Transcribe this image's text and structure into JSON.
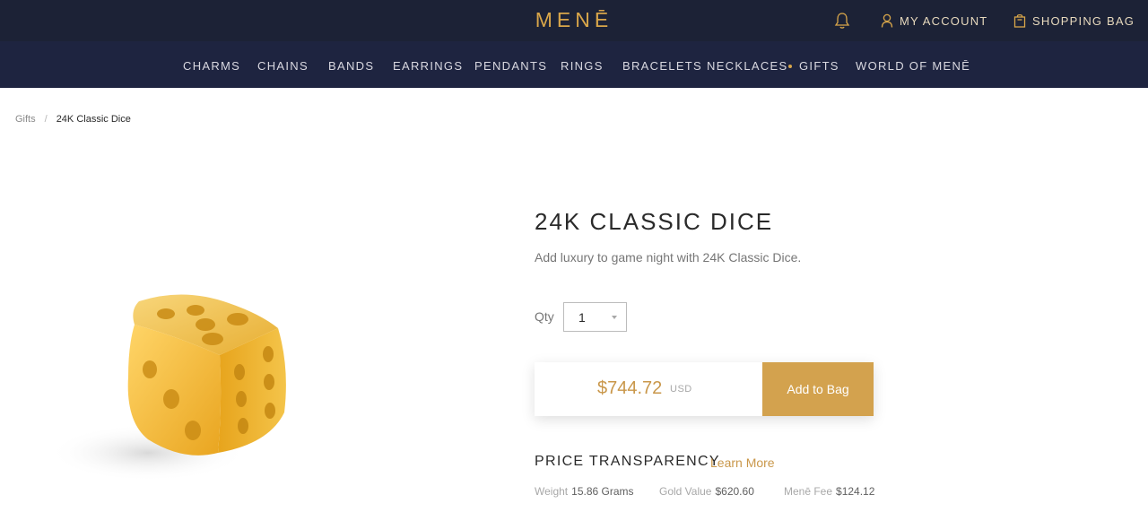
{
  "header": {
    "logo": "MENĒ",
    "my_account": "MY ACCOUNT",
    "shopping_bag": "SHOPPING BAG",
    "icons": {
      "notifications": "bell-icon",
      "account": "user-icon",
      "bag": "shopping-bag-icon"
    },
    "colors": {
      "top_bg": "#1c2236",
      "nav_bg": "#1e2440",
      "accent": "#d8a64a"
    }
  },
  "nav": {
    "items": [
      {
        "label": "CHARMS"
      },
      {
        "label": "CHAINS"
      },
      {
        "label": "BANDS"
      },
      {
        "label": "EARRINGS"
      },
      {
        "label": "PENDANTS"
      },
      {
        "label": "RINGS"
      },
      {
        "label": "BRACELETS"
      },
      {
        "label": "NECKLACES"
      },
      {
        "label": "GIFTS"
      },
      {
        "label": "WORLD OF MENĒ"
      }
    ]
  },
  "breadcrumb": {
    "parent": "Gifts",
    "separator": "/",
    "current": "24K Classic Dice"
  },
  "product": {
    "title": "24K CLASSIC DICE",
    "description": "Add luxury to game night with 24K Classic Dice.",
    "qty_label": "Qty",
    "qty_value": "1",
    "price": "$744.72",
    "currency": "USD",
    "add_to_bag": "Add to Bag"
  },
  "transparency": {
    "title": "PRICE TRANSPARENCY",
    "learn_more": "Learn More",
    "weight_label": "Weight",
    "weight_value": "15.86 Grams",
    "gold_label": "Gold Value",
    "gold_value": "$620.60",
    "fee_label": "Menē Fee",
    "fee_value": "$124.12"
  }
}
